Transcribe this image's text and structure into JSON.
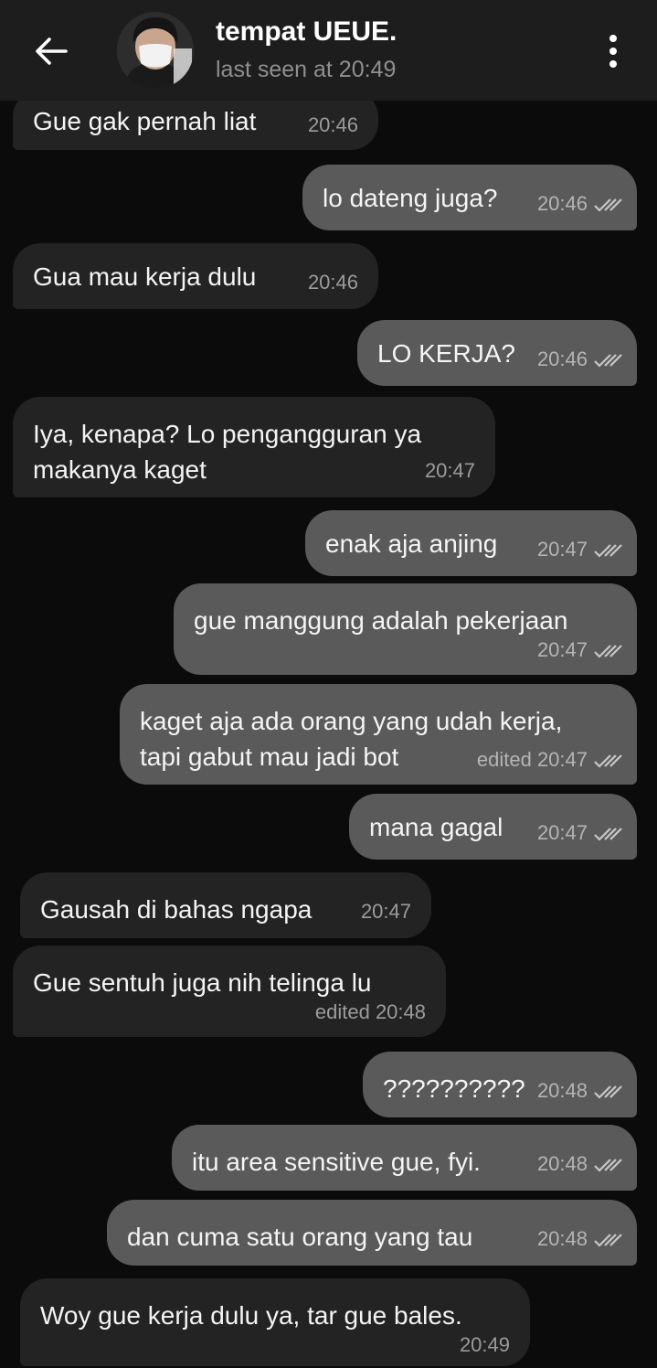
{
  "header": {
    "title": "tempat UEUE.",
    "status": "last seen at 20:49"
  },
  "messages": [
    {
      "dir": "in",
      "text": "Gue gak pernah liat",
      "time": "20:46"
    },
    {
      "dir": "out",
      "text": "lo dateng juga?",
      "time": "20:46",
      "read": true
    },
    {
      "dir": "in",
      "text": "Gua mau kerja dulu",
      "time": "20:46"
    },
    {
      "dir": "out",
      "text": "LO KERJA?",
      "time": "20:46",
      "read": true
    },
    {
      "dir": "in",
      "line1": "Iya, kenapa? Lo pengangguran ya",
      "line2": "makanya kaget",
      "time": "20:47"
    },
    {
      "dir": "out",
      "text": "enak aja anjing",
      "time": "20:47",
      "read": true
    },
    {
      "dir": "out",
      "text": "gue manggung adalah pekerjaan",
      "time": "20:47",
      "read": true
    },
    {
      "dir": "out",
      "line1": "kaget aja ada orang yang udah kerja,",
      "line2": "tapi gabut mau jadi bot",
      "time": "edited 20:47",
      "read": true
    },
    {
      "dir": "out",
      "text": "mana gagal",
      "time": "20:47",
      "read": true
    },
    {
      "dir": "in",
      "text": "Gausah di bahas ngapa",
      "time": "20:47"
    },
    {
      "dir": "in",
      "text": "Gue sentuh juga nih telinga lu",
      "time": "edited 20:48"
    },
    {
      "dir": "out",
      "text": "??????????",
      "time": "20:48",
      "read": true
    },
    {
      "dir": "out",
      "text": "itu area sensitive gue, fyi.",
      "time": "20:48",
      "read": true
    },
    {
      "dir": "out",
      "text": "dan cuma satu orang yang tau",
      "time": "20:48",
      "read": true
    },
    {
      "dir": "in",
      "text": "Woy gue kerja dulu ya, tar gue bales.",
      "time": "20:49"
    }
  ]
}
